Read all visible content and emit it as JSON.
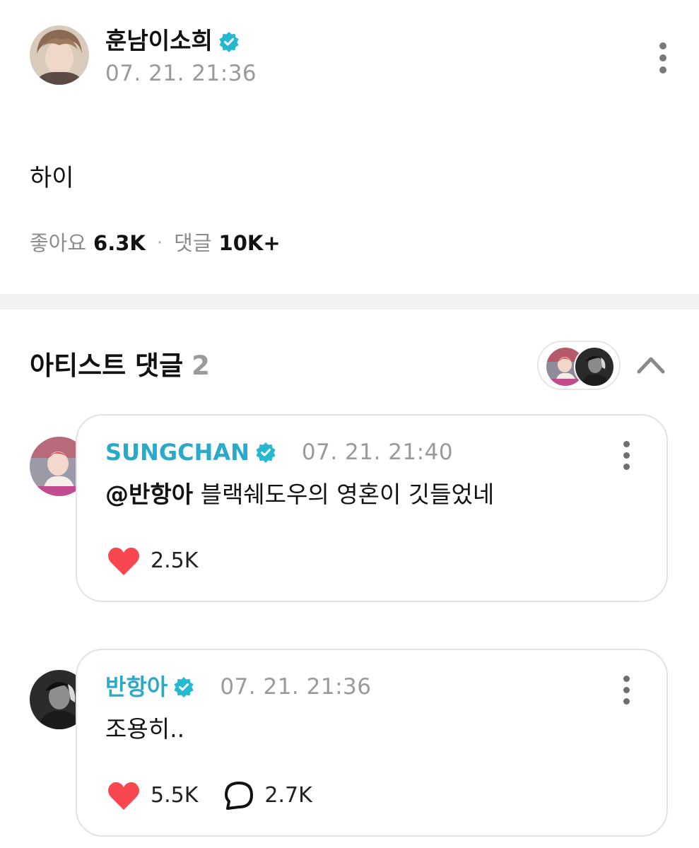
{
  "post": {
    "author": "훈남이소희",
    "time": "07. 21. 21:36",
    "body": "하이",
    "likes_label": "좋아요",
    "likes_count": "6.3K",
    "separator": "·",
    "comments_label": "댓글",
    "comments_count": "10K+"
  },
  "artist_comments": {
    "title": "아티스트 댓글",
    "count": "2",
    "comments": [
      {
        "author": "SUNGCHAN",
        "time": "07. 21. 21:40",
        "mention": "@반항아",
        "text": " 블랙쉐도우의 영혼이 깃들었네",
        "likes": "2.5K"
      },
      {
        "author": "반항아",
        "time": "07. 21. 21:36",
        "text": "조용히..",
        "likes": "5.5K",
        "replies": "2.7K"
      }
    ]
  },
  "colors": {
    "accent": "#2aa9c8",
    "verified": "#27b8d1",
    "heart": "#f8474f",
    "muted": "#9a9a9a",
    "divider": "#f2f2f2"
  },
  "icons": {
    "verified": "verified-badge-icon",
    "more": "more-vertical-icon",
    "collapse": "chevron-up-icon",
    "like": "heart-icon",
    "reply": "speech-bubble-icon"
  }
}
